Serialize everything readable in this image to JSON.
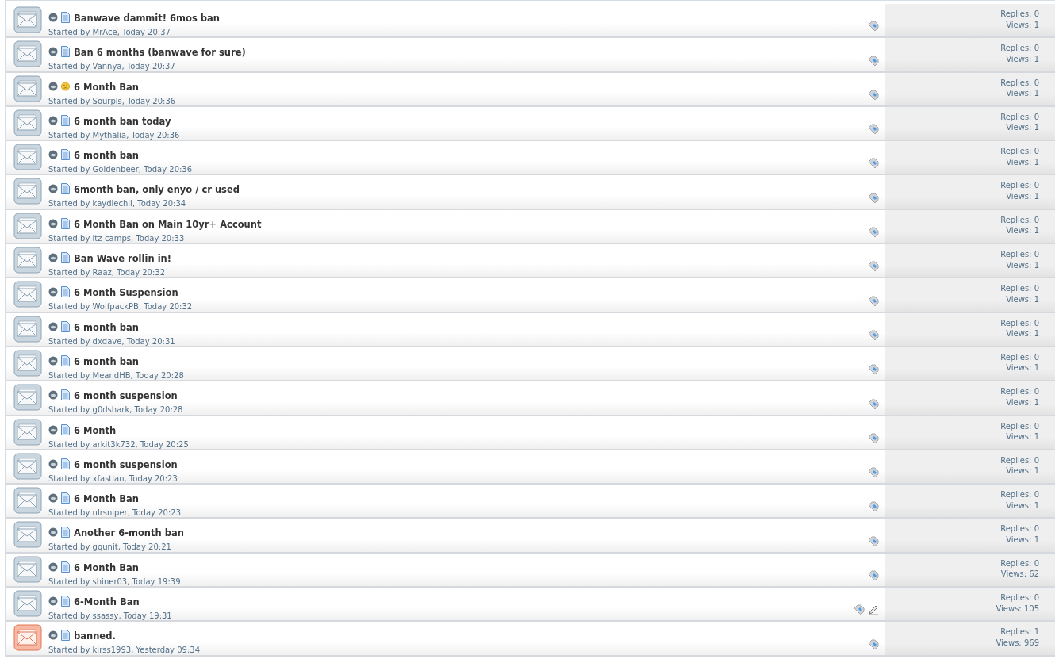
{
  "threads": [
    {
      "kind": "normal",
      "prefix": {
        "kind": "document"
      },
      "title": "Banwave dammit! 6mos ban",
      "byline_prefix": "Started by",
      "author": "MrAce",
      "separator": ",",
      "date": "Today 20:37",
      "edited": false,
      "replies": "Replies: 0",
      "views": "Views: 1"
    },
    {
      "kind": "normal",
      "prefix": {
        "kind": "document"
      },
      "title": "Ban 6 months (banwave for sure)",
      "byline_prefix": "Started by",
      "author": "Vannya",
      "separator": ",",
      "date": "Today 20:37",
      "edited": false,
      "replies": "Replies: 0",
      "views": "Views: 1"
    },
    {
      "kind": "normal",
      "prefix": {
        "kind": "sad"
      },
      "title": "6 Month Ban",
      "byline_prefix": "Started by",
      "author": "Sourpls",
      "separator": ",",
      "date": "Today 20:36",
      "edited": false,
      "replies": "Replies: 0",
      "views": "Views: 1"
    },
    {
      "kind": "normal",
      "prefix": {
        "kind": "document"
      },
      "title": "6 month ban today",
      "byline_prefix": "Started by",
      "author": "Mythalia",
      "separator": ",",
      "date": "Today 20:36",
      "edited": false,
      "replies": "Replies: 0",
      "views": "Views: 1"
    },
    {
      "kind": "normal",
      "prefix": {
        "kind": "document"
      },
      "title": "6 month ban",
      "byline_prefix": "Started by",
      "author": "Goldenbeer",
      "separator": ",",
      "date": "Today 20:36",
      "edited": false,
      "replies": "Replies: 0",
      "views": "Views: 1"
    },
    {
      "kind": "normal",
      "prefix": {
        "kind": "document"
      },
      "title": "6month ban, only enyo / cr used",
      "byline_prefix": "Started by",
      "author": "kaydiechii",
      "separator": ",",
      "date": "Today 20:34",
      "edited": false,
      "replies": "Replies: 0",
      "views": "Views: 1"
    },
    {
      "kind": "normal",
      "prefix": {
        "kind": "document"
      },
      "title": "6 Month Ban on Main 10yr+ Account",
      "byline_prefix": "Started by",
      "author": "itz-camps",
      "separator": ",",
      "date": "Today 20:33",
      "edited": false,
      "replies": "Replies: 0",
      "views": "Views: 1"
    },
    {
      "kind": "normal",
      "prefix": {
        "kind": "document"
      },
      "title": "Ban Wave rollin in!",
      "byline_prefix": "Started by",
      "author": "Raaz",
      "separator": ",",
      "date": "Today 20:32",
      "edited": false,
      "replies": "Replies: 0",
      "views": "Views: 1"
    },
    {
      "kind": "normal",
      "prefix": {
        "kind": "document"
      },
      "title": "6 Month Suspension",
      "byline_prefix": "Started by",
      "author": "WolfpackPB",
      "separator": ",",
      "date": "Today 20:32",
      "edited": false,
      "replies": "Replies: 0",
      "views": "Views: 1"
    },
    {
      "kind": "normal",
      "prefix": {
        "kind": "document"
      },
      "title": "6 month ban",
      "byline_prefix": "Started by",
      "author": "dxdave",
      "separator": ",",
      "date": "Today 20:31",
      "edited": false,
      "replies": "Replies: 0",
      "views": "Views: 1"
    },
    {
      "kind": "normal",
      "prefix": {
        "kind": "document"
      },
      "title": "6 month ban",
      "byline_prefix": "Started by",
      "author": "MeandHB",
      "separator": ",",
      "date": "Today 20:28",
      "edited": false,
      "replies": "Replies: 0",
      "views": "Views: 1"
    },
    {
      "kind": "normal",
      "prefix": {
        "kind": "document"
      },
      "title": "6 month suspension",
      "byline_prefix": "Started by",
      "author": "g0dshark",
      "separator": ",",
      "date": "Today 20:28",
      "edited": false,
      "replies": "Replies: 0",
      "views": "Views: 1"
    },
    {
      "kind": "normal",
      "prefix": {
        "kind": "document"
      },
      "title": "6 Month",
      "byline_prefix": "Started by",
      "author": "arkit3k732",
      "separator": ",",
      "date": "Today 20:25",
      "edited": false,
      "replies": "Replies: 0",
      "views": "Views: 1"
    },
    {
      "kind": "normal",
      "prefix": {
        "kind": "document"
      },
      "title": "6 month suspension",
      "byline_prefix": "Started by",
      "author": "xfastlan",
      "separator": ",",
      "date": "Today 20:23",
      "edited": false,
      "replies": "Replies: 0",
      "views": "Views: 1"
    },
    {
      "kind": "normal",
      "prefix": {
        "kind": "document"
      },
      "title": "6 Month Ban",
      "byline_prefix": "Started by",
      "author": "nlrsniper",
      "separator": ",",
      "date": "Today 20:23",
      "edited": false,
      "replies": "Replies: 0",
      "views": "Views: 1"
    },
    {
      "kind": "normal",
      "prefix": {
        "kind": "document"
      },
      "title": "Another 6-month ban",
      "byline_prefix": "Started by",
      "author": "gqunit",
      "separator": ",",
      "date": "Today 20:21",
      "edited": false,
      "replies": "Replies: 0",
      "views": "Views: 1"
    },
    {
      "kind": "normal",
      "prefix": {
        "kind": "document"
      },
      "title": "6 Month Ban",
      "byline_prefix": "Started by",
      "author": "shiner03",
      "separator": ",",
      "date": "Today 19:39",
      "edited": false,
      "replies": "Replies: 0",
      "views": "Views: 62"
    },
    {
      "kind": "normal",
      "prefix": {
        "kind": "document"
      },
      "title": "6-Month Ban",
      "byline_prefix": "Started by",
      "author": "ssassy",
      "separator": ",",
      "date": "Today 19:31",
      "edited": true,
      "replies": "Replies: 0",
      "views": "Views: 105"
    },
    {
      "kind": "hot",
      "prefix": {
        "kind": "document"
      },
      "title": "banned.",
      "byline_prefix": "Started by",
      "author": "kirss1993",
      "separator": ",",
      "date": "Yesterday 09:34",
      "edited": false,
      "replies": "Replies: 1",
      "views": "Views: 969"
    }
  ]
}
